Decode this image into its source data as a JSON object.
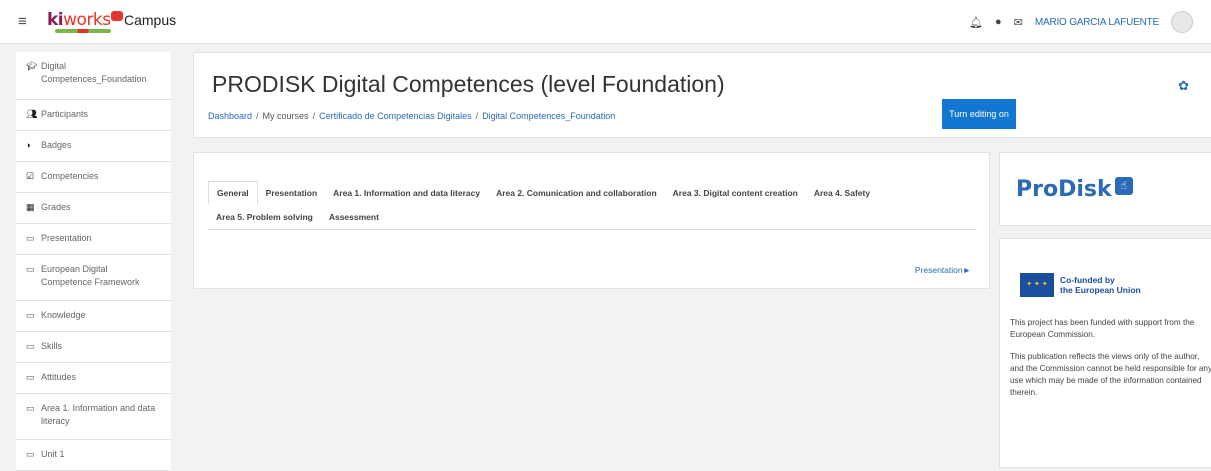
{
  "header": {
    "logo_ki": "ki",
    "logo_works": "works",
    "campus": "Campus",
    "user_name": "MARIO GARCIA LAFUENTE",
    "icons": [
      "bell-icon",
      "chat-icon",
      "mail-icon"
    ]
  },
  "sidebar": {
    "items": [
      {
        "label": "Digital Competences_Foundation",
        "icon": "graduation-cap-icon"
      },
      {
        "label": "Participants",
        "icon": "users-icon"
      },
      {
        "label": "Badges",
        "icon": "shield-icon"
      },
      {
        "label": "Competencies",
        "icon": "checkbox-icon"
      },
      {
        "label": "Grades",
        "icon": "table-icon"
      },
      {
        "label": "Presentation",
        "icon": "folder-icon"
      },
      {
        "label": "European Digital Competence Framework",
        "icon": "folder-icon"
      },
      {
        "label": "Knowledge",
        "icon": "folder-icon"
      },
      {
        "label": "Skills",
        "icon": "folder-icon"
      },
      {
        "label": "Attitudes",
        "icon": "folder-icon"
      },
      {
        "label": "Area 1. Information and data literacy",
        "icon": "folder-icon"
      },
      {
        "label": "Unit 1",
        "icon": "folder-icon"
      }
    ]
  },
  "course": {
    "title": "PRODISK Digital Competences (level Foundation)",
    "breadcrumb": [
      {
        "label": "Dashboard",
        "link": true
      },
      {
        "label": "My courses",
        "link": false
      },
      {
        "label": "Certificado de Competencias Digitales",
        "link": true
      },
      {
        "label": "Digital Competences_Foundation",
        "link": true
      }
    ],
    "edit_button": "Turn editing on"
  },
  "tabs": {
    "row1": [
      "General",
      "Presentation",
      "Area 1. Information and data literacy",
      "Area 2. Comunication and collaboration",
      "Area 3. Digital content creation",
      "Area 4. Safety"
    ],
    "row2": [
      "Area 5. Problem solving",
      "Assessment"
    ],
    "active": "General"
  },
  "next_link": "Presentation►",
  "blocks": {
    "logo_text": "ProDisk",
    "eu_line1": "Co-funded by",
    "eu_line2": "the European Union",
    "para1": "This project has been funded with support from the European Commission.",
    "para2": "This publication reflects the views only of the author, and the Commission cannot be held responsible for any use which may be made of the information contained therein."
  }
}
